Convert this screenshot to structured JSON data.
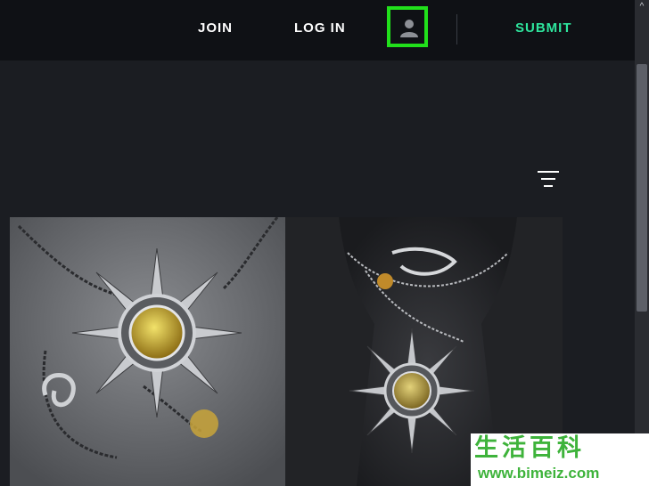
{
  "nav": {
    "join_label": "JOIN",
    "login_label": "LOG IN",
    "submit_label": "SUBMIT",
    "avatar_icon": "user-icon",
    "highlight_color": "#21e01b",
    "submit_color": "#2ee59d"
  },
  "toolbar": {
    "menu_icon": "filter-menu-icon"
  },
  "gallery": {
    "images": [
      {
        "icon": "sun-pendant-necklace-photo"
      },
      {
        "icon": "sun-pendant-on-bust-photo"
      }
    ]
  },
  "watermark": {
    "chars": "生活百科",
    "url": "www.bimeiz.com"
  }
}
